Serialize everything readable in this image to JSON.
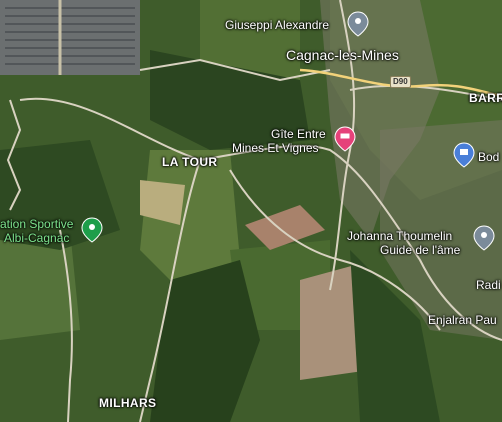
{
  "map": {
    "places": {
      "la_tour": "LA TOUR",
      "milhars": "MILHARS",
      "barr": "BARR",
      "cagnac": "Cagnac-les-Mines"
    },
    "pois": {
      "giuseppi": "Giuseppi Alexandre",
      "gite_line1": "Gîte Entre",
      "gite_line2": "Mines Et Vignes",
      "sportive_line1": "ation Sportive",
      "sportive_line2": "Albi-Cagnac",
      "johanna_line1": "Johanna Thoumelin",
      "johanna_line2": "Guide de l'âme",
      "bod": "Bod",
      "radi": "Radi",
      "enjalran": "Enjalran Pau"
    },
    "road_shield": "D90",
    "colors": {
      "sport_pin": "#1e9e4a",
      "lodging_pin": "#e5427a",
      "generic_pin": "#7b8b9a",
      "shop_pin": "#4a7fd8"
    },
    "icons": [
      "sport-pin-icon",
      "lodging-pin-icon",
      "place-pin-icon",
      "shopping-pin-icon"
    ]
  }
}
